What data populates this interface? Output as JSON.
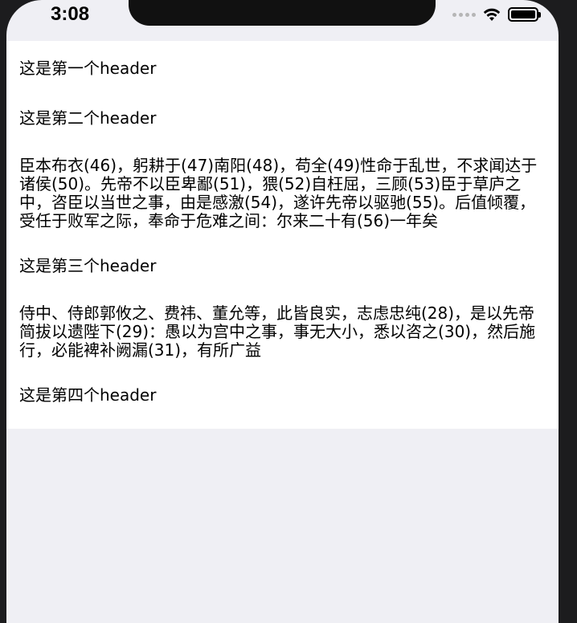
{
  "status_bar": {
    "time": "3:08"
  },
  "sections": {
    "h1": "这是第一个header",
    "h2": "这是第二个header",
    "p1": "臣本布衣(46)，躬耕于(47)南阳(48)，苟全(49)性命于乱世，不求闻达于诸侯(50)。先帝不以臣卑鄙(51)，猥(52)自枉屈，三顾(53)臣于草庐之中，咨臣以当世之事，由是感激(54)，遂许先帝以驱驰(55)。后值倾覆，受任于败军之际，奉命于危难之间：尔来二十有(56)一年矣",
    "h3": "这是第三个header",
    "p2": "侍中、侍郎郭攸之、费祎、董允等，此皆良实，志虑忠纯(28)，是以先帝简拔以遗陛下(29)：愚以为宫中之事，事无大小，悉以咨之(30)，然后施行，必能裨补阙漏(31)，有所广益",
    "h4": "这是第四个header"
  },
  "colors": {
    "background": "#efeff4",
    "content": "#ffffff",
    "text": "#000000"
  }
}
